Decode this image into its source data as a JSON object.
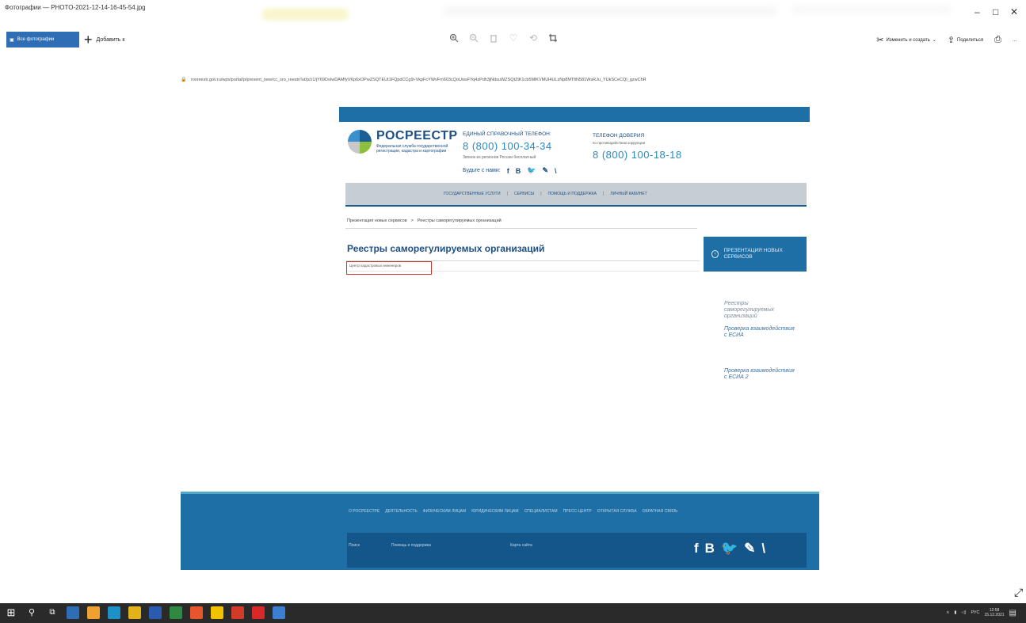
{
  "app": {
    "title": "Фотографии — PHOTO-2021-12-14-16-45-54.jpg",
    "win_min": "–",
    "win_max": "□",
    "win_close": "✕"
  },
  "toolbar": {
    "all_photos": "Все фотографии",
    "add": "Добавить к",
    "edit_create": "Изменить и создать",
    "share": "Поделиться",
    "more": "...",
    "icons": [
      "zoom-in-icon",
      "zoom-out-icon",
      "delete-icon",
      "favorite-icon",
      "rotate-icon",
      "crop-icon"
    ]
  },
  "browser": {
    "url": "rosreestr.gov.ru/wps/portal/p/present_new/cc_sro_reestr/!ut/p/z1/jY69DsIwDAMfyVKp6xOPwZSQTEUt1FQpdCCg9i-VkpFcYWvFm603cQoUwsFYq4zPdh3jNdsuWZSQtZtK1cb5MlKVMUl4ULzNp8MTfiN581WsRJu_YUkSCeCQI_gzwChR"
  },
  "site": {
    "brand": "РОСРЕЕСТР",
    "brand_sub": "Федеральная служба государственной регистрации, кадастра и картографии",
    "hotline_title": "ЕДИНЫЙ СПРАВОЧНЫЙ ТЕЛЕФОН:",
    "hotline_phone": "8 (800) 100-34-34",
    "hotline_note": "Звонок из регионов России бесплатный",
    "trust_title": "ТЕЛЕФОН ДОВЕРИЯ",
    "trust_note": "по противодействию коррупции",
    "trust_phone": "8 (800) 100-18-18",
    "social_label": "Будьте с нами:",
    "nav": [
      "ГОСУДАРСТВЕННЫЕ УСЛУГИ",
      "СЕРВИСЫ",
      "ПОМОЩЬ И ПОДДЕРЖКА",
      "ЛИЧНЫЙ КАБИНЕТ"
    ],
    "crumbs": [
      "Презентация новых сервисов",
      ">",
      "Реестры саморегулируемых организаций"
    ],
    "page_title": "Реестры саморегулируемых организаций",
    "search_value": "Центр кадастровых инженеров",
    "side_box": "ПРЕЗЕНТАЦИЯ НОВЫХ СЕРВИСОВ",
    "side_links": [
      "Реестры саморегулируемых организаций",
      "Проверка взаимодействия с ЕСИА",
      "Проверка взаимодействия с ЕСИА 2"
    ],
    "footer_nav": [
      "О РОСРЕЕСТРЕ",
      "ДЕЯТЕЛЬНОСТЬ",
      "ФИЗИЧЕСКИМ ЛИЦАМ",
      "ЮРИДИЧЕСКИМ ЛИЦАМ",
      "СПЕЦИАЛИСТАМ",
      "ПРЕСС-ЦЕНТР",
      "ОТКРЫТАЯ СЛУЖБА",
      "ОБРАТНАЯ СВЯЗЬ"
    ],
    "footer_links": [
      "Поиск",
      "Помощь и поддержка",
      "Карта сайта"
    ]
  },
  "taskbar": {
    "lang": "РУС",
    "time": "12:58",
    "date": "15.12.2021",
    "icon_colors": [
      "#2f6db4",
      "#f0a030",
      "#1e90c8",
      "#e2b21c",
      "#2b5bb0",
      "#2d8a3e",
      "#e6552b",
      "#f2c200",
      "#d23a2a",
      "#d92828",
      "#3a7fd0"
    ]
  }
}
